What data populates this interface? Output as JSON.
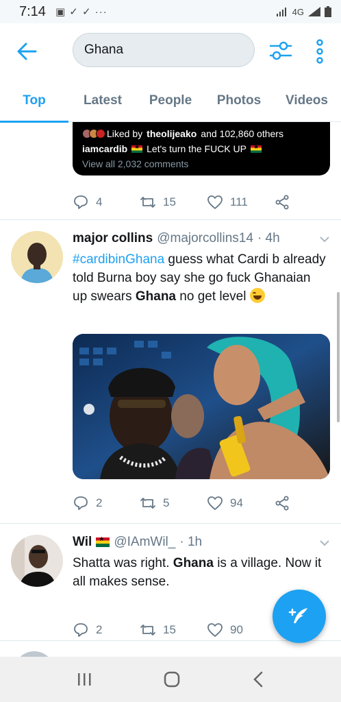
{
  "status_bar": {
    "time": "7:14",
    "left_icons": "▣ ✓ ✓  ···",
    "network": "4G"
  },
  "search": {
    "query": "Ghana"
  },
  "tabs": [
    {
      "label": "Top",
      "active": true
    },
    {
      "label": "Latest",
      "active": false
    },
    {
      "label": "People",
      "active": false
    },
    {
      "label": "Photos",
      "active": false
    },
    {
      "label": "Videos",
      "active": false
    }
  ],
  "embed": {
    "liked_prefix": "Liked by",
    "liked_user": "theolijeako",
    "liked_suffix": "and 102,860 others",
    "caption_user": "iamcardib",
    "caption_text": "Let's turn the FUCK UP",
    "comments": "View all 2,032 comments"
  },
  "tweet0_actions": {
    "replies": "4",
    "retweets": "15",
    "likes": "111"
  },
  "tweet1": {
    "name": "major collins",
    "handle": "@majorcollins14",
    "time": "· 4h",
    "hashtag": "#cardibinGhana",
    "text_a": " guess what Cardi b already told Burna boy say she go fuck Ghanaian up swears ",
    "bold": "Ghana",
    "text_b": " no get level ",
    "replies": "2",
    "retweets": "5",
    "likes": "94"
  },
  "tweet2": {
    "name": "Wil",
    "handle": "@IAmWil_",
    "time": "· 1h",
    "text_a": "Shatta was right. ",
    "bold": "Ghana",
    "text_b": " is a village. Now it all makes sense.",
    "replies": "2",
    "retweets": "15",
    "likes": "90"
  },
  "colors": {
    "accent": "#1da1f2",
    "muted": "#657786",
    "text": "#14171a"
  }
}
